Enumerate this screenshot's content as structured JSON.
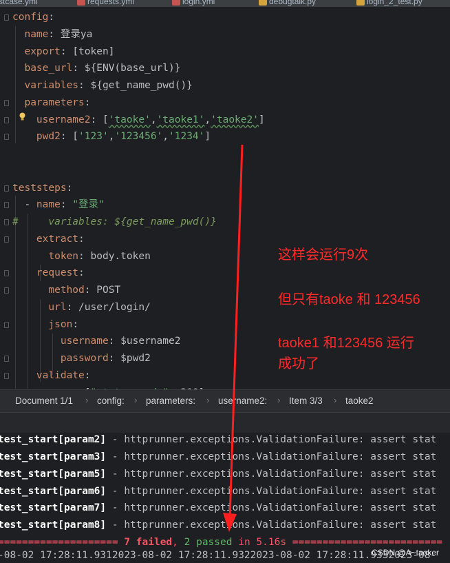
{
  "tabs": [
    "testcase.yml",
    "requests.yml",
    "login.yml",
    "debugtalk.py",
    "login_2_test.py"
  ],
  "code_lines": [
    {
      "parts": [
        [
          "key",
          "config"
        ],
        [
          "plain",
          ":"
        ]
      ]
    },
    {
      "parts": [
        [
          "plain",
          "  "
        ],
        [
          "key",
          "name"
        ],
        [
          "plain",
          ": 登录ya"
        ]
      ]
    },
    {
      "parts": [
        [
          "plain",
          "  "
        ],
        [
          "key",
          "export"
        ],
        [
          "plain",
          ": [token]"
        ]
      ]
    },
    {
      "parts": [
        [
          "plain",
          "  "
        ],
        [
          "key",
          "base_url"
        ],
        [
          "plain",
          ": ${ENV(base_url)}"
        ]
      ]
    },
    {
      "parts": [
        [
          "plain",
          "  "
        ],
        [
          "key",
          "variables"
        ],
        [
          "plain",
          ": ${get_name_pwd()}"
        ]
      ]
    },
    {
      "parts": [
        [
          "plain",
          "  "
        ],
        [
          "key",
          "parameters"
        ],
        [
          "plain",
          ":"
        ]
      ]
    },
    {
      "parts": [
        [
          "plain",
          "    "
        ],
        [
          "key",
          "username2"
        ],
        [
          "plain",
          ": ["
        ],
        [
          "strw",
          "'taoke'"
        ],
        [
          "plain",
          ","
        ],
        [
          "strw",
          "'taoke1'"
        ],
        [
          "plain",
          ","
        ],
        [
          "strw",
          "'taoke2'"
        ],
        [
          "plain",
          "]"
        ]
      ]
    },
    {
      "parts": [
        [
          "plain",
          "    "
        ],
        [
          "key",
          "pwd2"
        ],
        [
          "plain",
          ": ["
        ],
        [
          "str",
          "'123'"
        ],
        [
          "plain",
          ","
        ],
        [
          "str",
          "'123456'"
        ],
        [
          "plain",
          ","
        ],
        [
          "str",
          "'1234'"
        ],
        [
          "plain",
          "]"
        ]
      ]
    },
    {
      "parts": []
    },
    {
      "parts": []
    },
    {
      "parts": [
        [
          "key",
          "teststeps"
        ],
        [
          "plain",
          ":"
        ]
      ]
    },
    {
      "parts": [
        [
          "plain",
          "  - "
        ],
        [
          "key",
          "name"
        ],
        [
          "plain",
          ": "
        ],
        [
          "str",
          "\"登录\""
        ]
      ]
    },
    {
      "parts": [
        [
          "cmt",
          "#     variables: ${get_name_pwd()}"
        ]
      ]
    },
    {
      "parts": [
        [
          "plain",
          "    "
        ],
        [
          "key",
          "extract"
        ],
        [
          "plain",
          ":"
        ]
      ]
    },
    {
      "parts": [
        [
          "plain",
          "      "
        ],
        [
          "key",
          "token"
        ],
        [
          "plain",
          ": body.token"
        ]
      ]
    },
    {
      "parts": [
        [
          "plain",
          "    "
        ],
        [
          "key",
          "request"
        ],
        [
          "plain",
          ":"
        ]
      ]
    },
    {
      "parts": [
        [
          "plain",
          "      "
        ],
        [
          "key",
          "method"
        ],
        [
          "plain",
          ": POST"
        ]
      ]
    },
    {
      "parts": [
        [
          "plain",
          "      "
        ],
        [
          "key",
          "url"
        ],
        [
          "plain",
          ": /user/login/"
        ]
      ]
    },
    {
      "parts": [
        [
          "plain",
          "      "
        ],
        [
          "key",
          "json"
        ],
        [
          "plain",
          ":"
        ]
      ]
    },
    {
      "parts": [
        [
          "plain",
          "        "
        ],
        [
          "key",
          "username"
        ],
        [
          "plain",
          ": $username2"
        ]
      ]
    },
    {
      "parts": [
        [
          "plain",
          "        "
        ],
        [
          "key",
          "password"
        ],
        [
          "plain",
          ": $pwd2"
        ]
      ]
    },
    {
      "parts": [
        [
          "plain",
          "    "
        ],
        [
          "key",
          "validate"
        ],
        [
          "plain",
          ":"
        ]
      ]
    },
    {
      "parts": [
        [
          "plain",
          "      - "
        ],
        [
          "key",
          "eq"
        ],
        [
          "plain",
          ": ["
        ],
        [
          "str",
          "\"status_code\""
        ],
        [
          "plain",
          ", 200]"
        ]
      ]
    }
  ],
  "annotations": {
    "line1": "这样会运行9次",
    "line2": "但只有taoke 和 123456",
    "line3": "taoke1 和123456  运行",
    "line4": "成功了"
  },
  "breadcrumb": [
    "Document 1/1",
    "config:",
    "parameters:",
    "username2:",
    "Item 3/3",
    "taoke2"
  ],
  "console": {
    "rows": [
      {
        "test": "test_start[param2]",
        "rest": " - httprunner.exceptions.ValidationFailure: assert stat"
      },
      {
        "test": "test_start[param3]",
        "rest": " - httprunner.exceptions.ValidationFailure: assert stat"
      },
      {
        "test": "test_start[param5]",
        "rest": " - httprunner.exceptions.ValidationFailure: assert stat"
      },
      {
        "test": "test_start[param6]",
        "rest": " - httprunner.exceptions.ValidationFailure: assert stat"
      },
      {
        "test": "test_start[param7]",
        "rest": " - httprunner.exceptions.ValidationFailure: assert stat"
      },
      {
        "test": "test_start[param8]",
        "rest": " - httprunner.exceptions.ValidationFailure: assert stat"
      }
    ],
    "summary_left": "==================== ",
    "summary_failed": "7 failed",
    "summary_comma": ", ",
    "summary_passed": "2 passed",
    "summary_time": " in 5.16s",
    "summary_right": " =========================",
    "timestamp_line": "-08-02 17:28:11.9312023-08-02 17:28:11.9322023-08-02 17:28:11.9332023-08-"
  },
  "watermark": "CSDN @A~taoker",
  "colors": {
    "annotation": "#ff2a2a",
    "key": "#cf8e6d",
    "string": "#6aab73",
    "comment": "#7a9a5c",
    "failed": "#f75464",
    "passed": "#5fb865"
  }
}
